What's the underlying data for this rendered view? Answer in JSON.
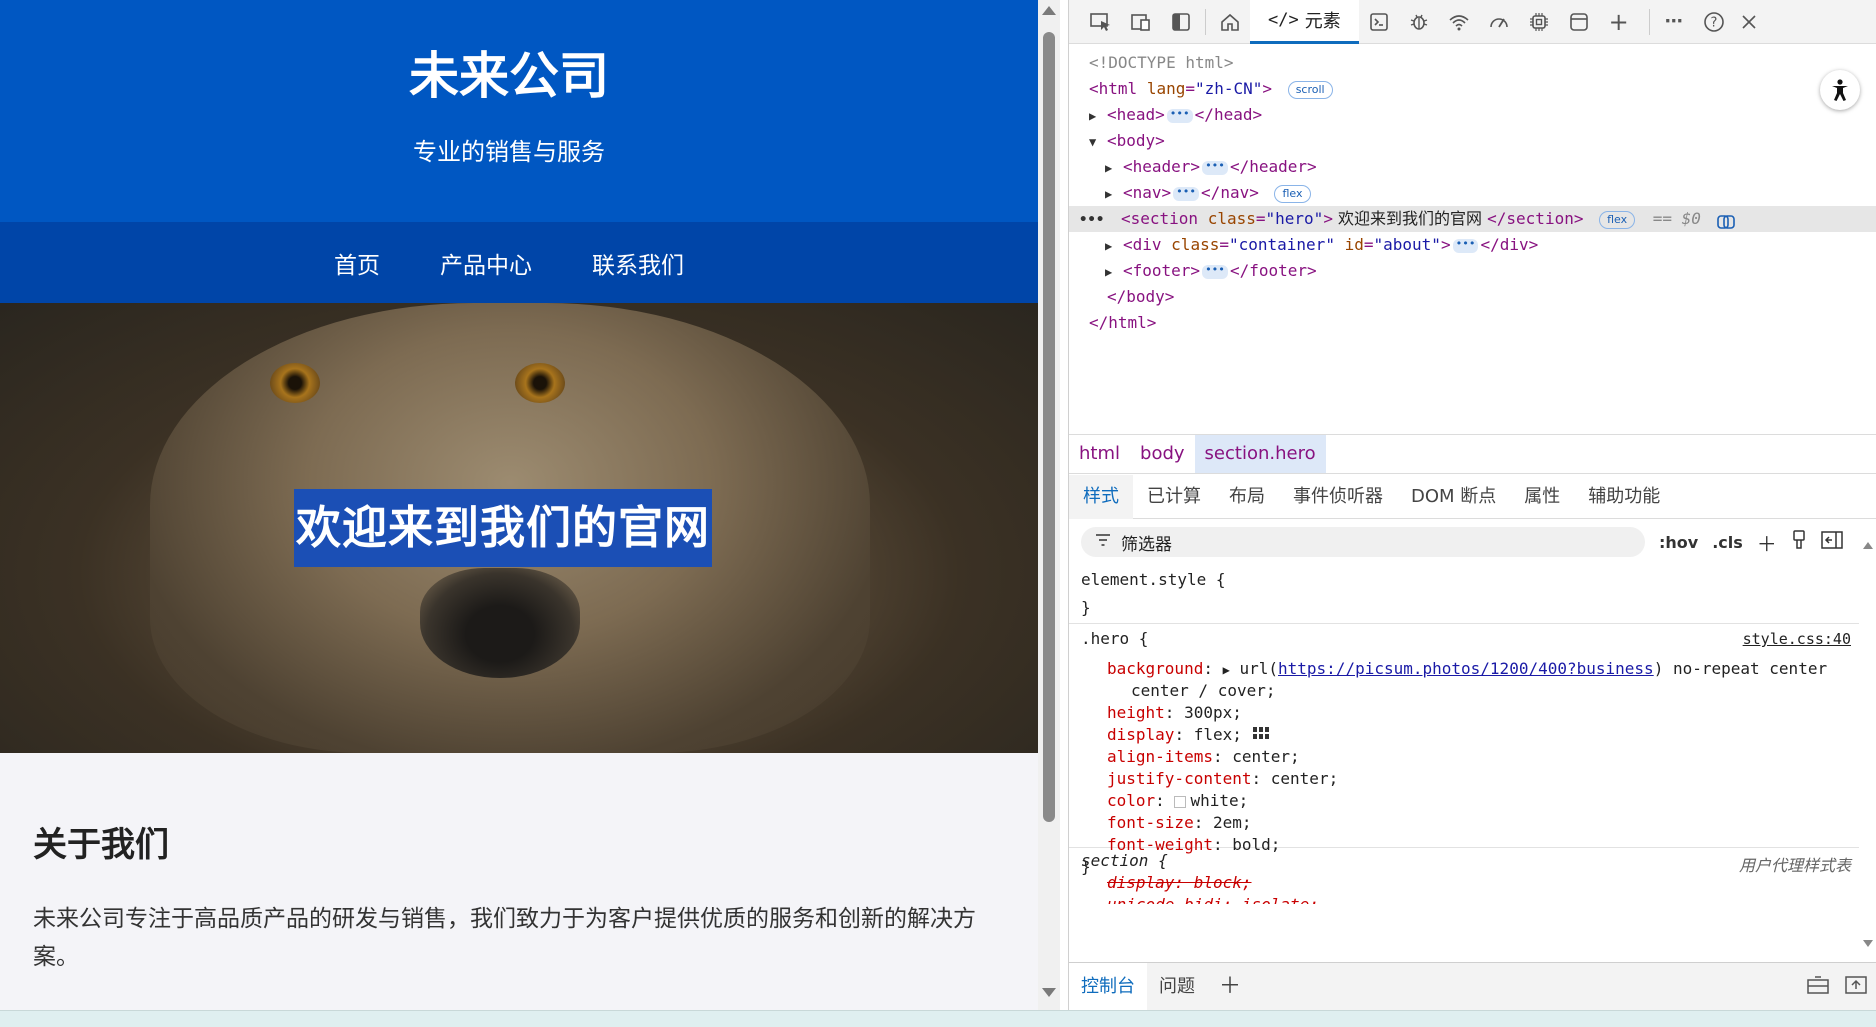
{
  "site": {
    "title": "未来公司",
    "subtitle": "专业的销售与服务",
    "nav": [
      "首页",
      "产品中心",
      "联系我们"
    ],
    "hero_title": "欢迎来到我们的官网",
    "about_heading": "关于我们",
    "about_text": "未来公司专注于高品质产品的研发与销售，我们致力于为客户提供优质的服务和创新的解决方案。"
  },
  "devtools": {
    "toolbar": {
      "elements_tab_label": "元素",
      "icons": [
        "inspect-icon",
        "device-emulation-icon",
        "sidebar-icon",
        "home-icon",
        "elements-icon",
        "console-icon",
        "bug-icon",
        "network-icon",
        "performance-icon",
        "memory-icon",
        "application-icon",
        "add-tab-icon",
        "more-icon",
        "help-icon",
        "close-icon"
      ]
    },
    "dom": {
      "doctype": "<!DOCTYPE html>",
      "html_open_tag": "<html",
      "html_lang_attr": "lang",
      "html_lang_value": "\"zh-CN\"",
      "html_close_bracket": ">",
      "html_badge": "scroll",
      "head_open": "<head>",
      "head_close": "</head>",
      "body_open": "<body>",
      "header_open": "<header>",
      "header_close": "</header>",
      "nav_open": "<nav>",
      "nav_close": "</nav>",
      "nav_badge": "flex",
      "section_open": "<section",
      "section_class_attr": "class",
      "section_class_value": "\"hero\"",
      "section_text": " 欢迎来到我们的官网 ",
      "section_close": "</section>",
      "section_badge": "flex",
      "section_eq": "== $0",
      "div_open": "<div",
      "div_class_attr": "class",
      "div_class_value": "\"container\"",
      "div_id_attr": "id",
      "div_id_value": "\"about\"",
      "div_close": "</div>",
      "footer_open": "<footer>",
      "footer_close": "</footer>",
      "body_close": "</body>",
      "html_close": "</html>"
    },
    "breadcrumb": [
      "html",
      "body",
      "section.hero"
    ],
    "panel_tabs": [
      "样式",
      "已计算",
      "布局",
      "事件侦听器",
      "DOM 断点",
      "属性",
      "辅助功能"
    ],
    "filter": {
      "placeholder": "筛选器",
      "hov": ":hov",
      "cls": ".cls"
    },
    "styles": {
      "element_style": "element.style {",
      "close_brace": "}",
      "hero_selector": ".hero {",
      "hero_source": "style.css:40",
      "background_prop": "background",
      "background_url": "https://picsum.photos/1200/400?business",
      "background_rest": " no-repeat center",
      "background_cont": "center / cover;",
      "height_prop": "height",
      "height_val": " 300px;",
      "display_prop": "display",
      "display_val": " flex;",
      "align_prop": "align-items",
      "align_val": " center;",
      "justify_prop": "justify-content",
      "justify_val": " center;",
      "color_prop": "color",
      "color_val": "white;",
      "fontsize_prop": "font-size",
      "fontsize_val": " 2em;",
      "fontweight_prop": "font-weight",
      "fontweight_val": " bold;",
      "section_selector": "section {",
      "ua_label": "用户代理样式表",
      "ua_display": "display: block;",
      "ua_unicode": "unicode-bidi: isolate;"
    },
    "drawer": {
      "console": "控制台",
      "issues": "问题"
    }
  }
}
